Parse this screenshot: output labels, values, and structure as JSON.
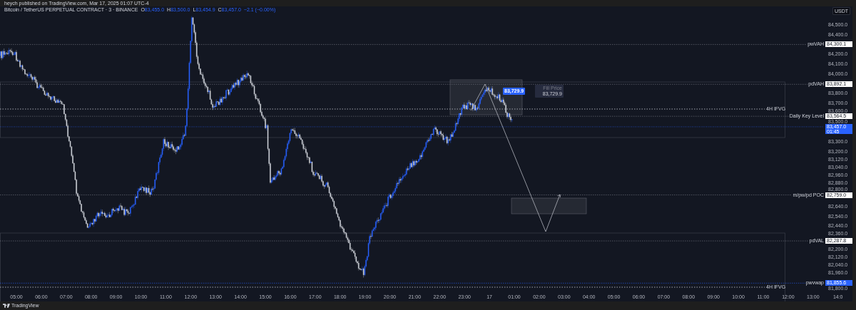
{
  "header": {
    "text": "heych published on TradingView.com, Mar 17, 2025 01:07 UTC-4"
  },
  "legend": {
    "symbol": "Bitcoin / TetherUS PERPETUAL CONTRACT · 3 · BINANCE",
    "ohlc": [
      {
        "label": "O",
        "value": "83,455.0"
      },
      {
        "label": "H",
        "value": "83,500.0"
      },
      {
        "label": "L",
        "value": "83,454.9"
      },
      {
        "label": "C",
        "value": "83,457.0"
      }
    ],
    "change": "−2.1 (−0.00%)"
  },
  "currency": "USDT",
  "price_axis": {
    "labels": [
      "84,500.0",
      "84,400.0",
      "84,200.0",
      "84,100.0",
      "84,000.0",
      "83,800.0",
      "83,700.0",
      "83,600.0",
      "83,500.0",
      "83,300.0",
      "83,200.0",
      "83,120.0",
      "83,040.0",
      "82,960.0",
      "82,880.0",
      "82,800.0",
      "82,640.0",
      "82,540.0",
      "82,440.0",
      "82,360.0",
      "82,200.0",
      "82,120.0",
      "82,040.0",
      "81,960.0",
      "81,800.0"
    ]
  },
  "levels": [
    {
      "label": "pwVAH",
      "price": "84,300.1",
      "kind": "white"
    },
    {
      "label": "pdVAH",
      "price": "83,892.1",
      "kind": "white"
    },
    {
      "label": "Daily Key Level",
      "price": "83,564.5",
      "kind": "white"
    },
    {
      "label": "m/pw/pd POC",
      "price": "82,759.0",
      "kind": "white"
    },
    {
      "label": "pdVAL",
      "price": "82,287.8",
      "kind": "white"
    },
    {
      "label": "pwvwap",
      "price": "81,855.6",
      "kind": "blue"
    }
  ],
  "current_price": {
    "price": "83,457.0",
    "countdown": "01:45"
  },
  "zones": [
    {
      "label": "4H IFVG"
    },
    {
      "label": "4H IFVG"
    }
  ],
  "order_tag": "83,729.9",
  "fill_tooltip": {
    "title": "Fill Price",
    "price": "83,729.9"
  },
  "time_axis": [
    "05:00",
    "06:00",
    "07:00",
    "08:00",
    "09:00",
    "10:00",
    "11:00",
    "12:00",
    "13:00",
    "14:00",
    "15:00",
    "16:00",
    "17:00",
    "18:00",
    "19:00",
    "20:00",
    "21:00",
    "22:00",
    "23:00",
    "17",
    "01:00",
    "02:00",
    "03:00",
    "04:00",
    "05:00",
    "06:00",
    "07:00",
    "08:00",
    "09:00",
    "10:00",
    "11:00",
    "12:00",
    "13:00",
    "14:0"
  ],
  "footer": {
    "brand": "TradingView"
  }
}
